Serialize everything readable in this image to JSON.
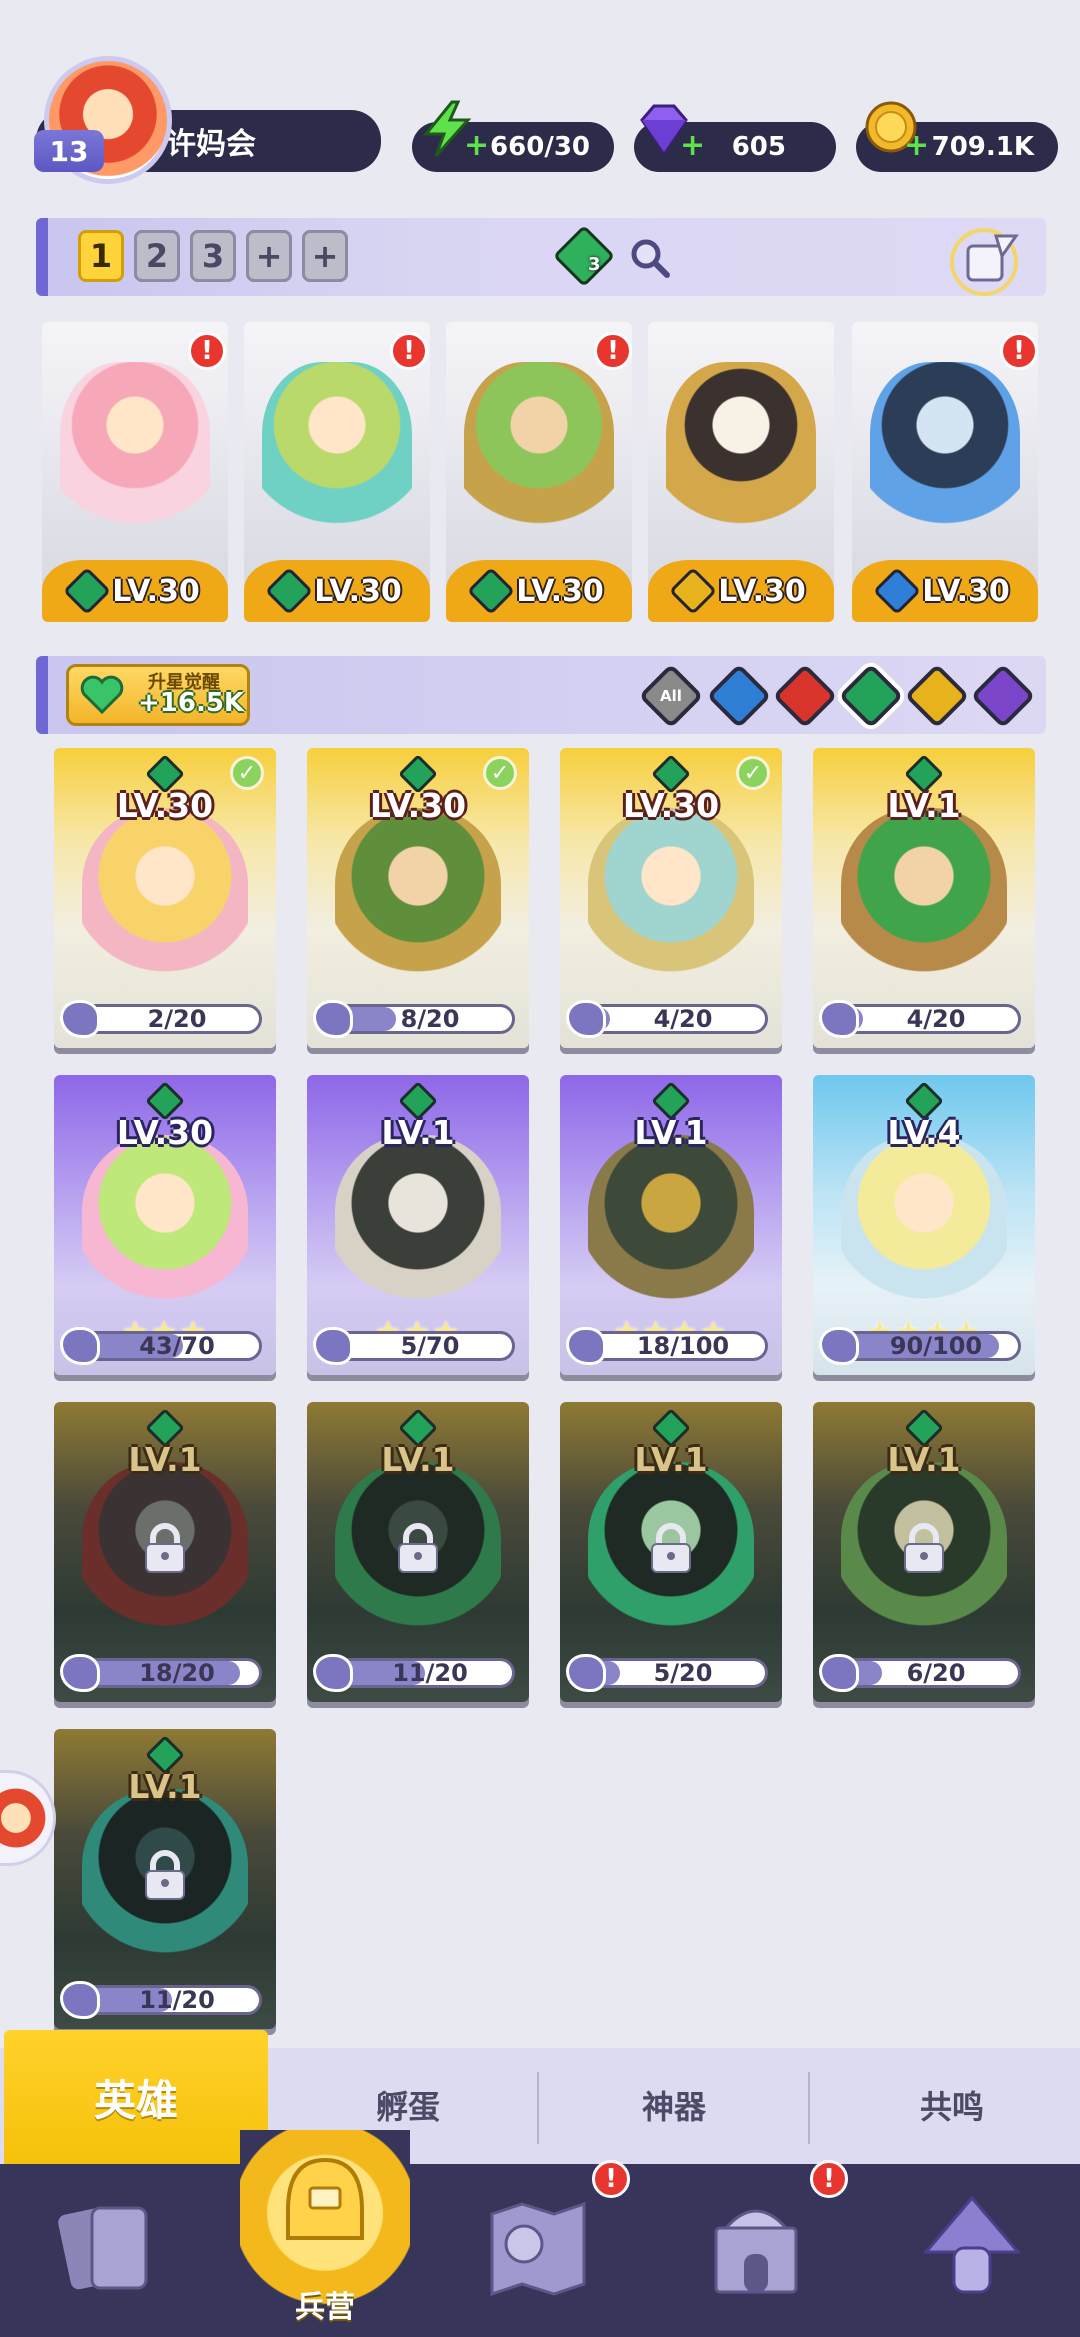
{
  "player": {
    "name": "许妈会",
    "level": "13"
  },
  "resources": {
    "energy": "660/30",
    "gems": "605",
    "coins": "709.1K"
  },
  "team_tabs": [
    "1",
    "2",
    "3",
    "+",
    "+"
  ],
  "team_tab_active": "1",
  "filter_badge_count": "3",
  "team_heroes": [
    {
      "level": "LV.30",
      "element": "nature",
      "alert": "!"
    },
    {
      "level": "LV.30",
      "element": "nature",
      "alert": "!"
    },
    {
      "level": "LV.30",
      "element": "nature",
      "alert": "!"
    },
    {
      "level": "LV.30",
      "element": "light",
      "alert": ""
    },
    {
      "level": "LV.30",
      "element": "water",
      "alert": "!"
    }
  ],
  "awaken": {
    "title": "升星觉醒",
    "value": "+16.5K"
  },
  "element_filters": [
    {
      "name": "All",
      "label": "All",
      "color": "#8a8a8a"
    },
    {
      "name": "water",
      "label": "",
      "color": "#2f7fd6"
    },
    {
      "name": "fire",
      "label": "",
      "color": "#d9342b"
    },
    {
      "name": "nature",
      "label": "",
      "color": "#23a35a"
    },
    {
      "name": "light",
      "label": "",
      "color": "#e8b21c"
    },
    {
      "name": "dark",
      "label": "",
      "color": "#7a45c9"
    }
  ],
  "heroes": [
    {
      "level": "LV.30",
      "fragments": "2/20",
      "progress": 0.1,
      "stars": "",
      "rarity": "gold",
      "owned_check": true,
      "locked": false
    },
    {
      "level": "LV.30",
      "fragments": "8/20",
      "progress": 0.4,
      "stars": "",
      "rarity": "gold",
      "owned_check": true,
      "locked": false
    },
    {
      "level": "LV.30",
      "fragments": "4/20",
      "progress": 0.2,
      "stars": "",
      "rarity": "gold",
      "owned_check": true,
      "locked": false
    },
    {
      "level": "LV.1",
      "fragments": "4/20",
      "progress": 0.2,
      "stars": "",
      "rarity": "gold",
      "owned_check": false,
      "locked": false
    },
    {
      "level": "LV.30",
      "fragments": "43/70",
      "progress": 0.614,
      "stars": "★★★",
      "rarity": "purple",
      "owned_check": false,
      "locked": false
    },
    {
      "level": "LV.1",
      "fragments": "5/70",
      "progress": 0.071,
      "stars": "★★★",
      "rarity": "purple",
      "owned_check": false,
      "locked": false
    },
    {
      "level": "LV.1",
      "fragments": "18/100",
      "progress": 0.18,
      "stars": "★★★★",
      "rarity": "purple",
      "owned_check": false,
      "locked": false
    },
    {
      "level": "LV.4",
      "fragments": "90/100",
      "progress": 0.9,
      "stars": "★★★★",
      "rarity": "blue",
      "owned_check": false,
      "locked": false
    },
    {
      "level": "LV.1",
      "fragments": "18/20",
      "progress": 0.9,
      "stars": "",
      "rarity": "locked",
      "owned_check": false,
      "locked": true
    },
    {
      "level": "LV.1",
      "fragments": "11/20",
      "progress": 0.55,
      "stars": "",
      "rarity": "locked",
      "owned_check": false,
      "locked": true
    },
    {
      "level": "LV.1",
      "fragments": "5/20",
      "progress": 0.25,
      "stars": "",
      "rarity": "locked",
      "owned_check": false,
      "locked": true
    },
    {
      "level": "LV.1",
      "fragments": "6/20",
      "progress": 0.3,
      "stars": "",
      "rarity": "locked",
      "owned_check": false,
      "locked": true
    },
    {
      "level": "LV.1",
      "fragments": "11/20",
      "progress": 0.55,
      "stars": "",
      "rarity": "locked",
      "owned_check": false,
      "locked": true
    }
  ],
  "tabs": {
    "hero": "英雄",
    "hatch": "孵蛋",
    "artifact": "神器",
    "resonance": "共鸣"
  },
  "nav": {
    "barracks": "兵营"
  },
  "colors": {
    "accent_gold": "#f5c10a",
    "nav_bg": "#37355a",
    "alert_red": "#e8362f"
  }
}
